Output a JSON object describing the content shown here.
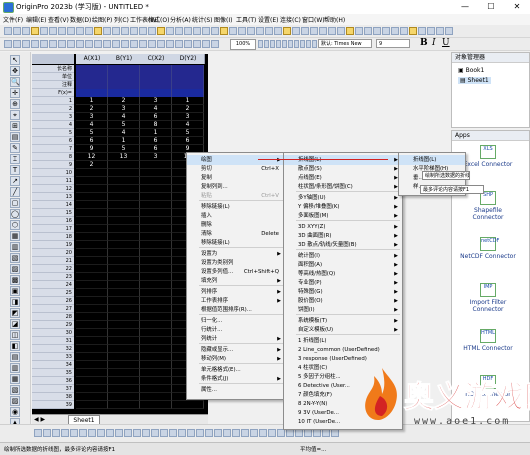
{
  "window": {
    "title": "OriginPro 2023b (学习版) - UNTITLED *",
    "buttons": [
      "—",
      "☐",
      "✕"
    ]
  },
  "menubar": [
    "文件(F)",
    "编辑(E)",
    "查看(V)",
    "数据(D)",
    "绘图(P)",
    "列(C)",
    "工作表(W)",
    "格式(O)",
    "分析(A)",
    "统计(S)",
    "图像(I)",
    "工具(T)",
    "设置(E)",
    "连接(C)",
    "窗口(W)",
    "帮助(H)"
  ],
  "toolbar2": {
    "zoom": "100%",
    "font_name": "默认: Times New",
    "font_size": "9"
  },
  "sheet": {
    "columns": [
      "A(X1)",
      "B(Y1)",
      "C(X2)",
      "D(Y2)"
    ],
    "header_rows": [
      "长名称",
      "单位",
      "注释",
      "F(x)="
    ],
    "rows": [
      [
        "1",
        "1",
        "2",
        "3",
        "1"
      ],
      [
        "2",
        "2",
        "3",
        "4",
        "2"
      ],
      [
        "3",
        "3",
        "4",
        "6",
        "3"
      ],
      [
        "4",
        "4",
        "5",
        "8",
        "4"
      ],
      [
        "5",
        "5",
        "4",
        "1",
        "5"
      ],
      [
        "6",
        "6",
        "1",
        "6",
        "6"
      ],
      [
        "7",
        "9",
        "5",
        "6",
        "9"
      ],
      [
        "8",
        "12",
        "13",
        "3",
        "12"
      ],
      [
        "9",
        "2",
        "",
        "",
        "2"
      ],
      [
        "10",
        "",
        "",
        "",
        ""
      ],
      [
        "11",
        "",
        "",
        "",
        ""
      ],
      [
        "12",
        "",
        "",
        "",
        ""
      ],
      [
        "13",
        "",
        "",
        "",
        ""
      ],
      [
        "14",
        "",
        "",
        "",
        ""
      ],
      [
        "15",
        "",
        "",
        "",
        ""
      ],
      [
        "16",
        "",
        "",
        "",
        ""
      ],
      [
        "17",
        "",
        "",
        "",
        ""
      ],
      [
        "18",
        "",
        "",
        "",
        ""
      ],
      [
        "19",
        "",
        "",
        "",
        ""
      ],
      [
        "20",
        "",
        "",
        "",
        ""
      ],
      [
        "21",
        "",
        "",
        "",
        ""
      ],
      [
        "22",
        "",
        "",
        "",
        ""
      ],
      [
        "23",
        "",
        "",
        "",
        ""
      ],
      [
        "24",
        "",
        "",
        "",
        ""
      ],
      [
        "25",
        "",
        "",
        "",
        ""
      ],
      [
        "26",
        "",
        "",
        "",
        ""
      ],
      [
        "27",
        "",
        "",
        "",
        ""
      ],
      [
        "28",
        "",
        "",
        "",
        ""
      ],
      [
        "29",
        "",
        "",
        "",
        ""
      ],
      [
        "30",
        "",
        "",
        "",
        ""
      ],
      [
        "31",
        "",
        "",
        "",
        ""
      ],
      [
        "32",
        "",
        "",
        "",
        ""
      ],
      [
        "33",
        "",
        "",
        "",
        ""
      ],
      [
        "34",
        "",
        "",
        "",
        ""
      ],
      [
        "35",
        "",
        "",
        "",
        ""
      ],
      [
        "36",
        "",
        "",
        "",
        ""
      ],
      [
        "37",
        "",
        "",
        "",
        ""
      ],
      [
        "38",
        "",
        "",
        "",
        ""
      ],
      [
        "39",
        "",
        "",
        "",
        ""
      ]
    ],
    "tab": "Sheet1"
  },
  "context_menu": [
    {
      "label": "绘图",
      "arrow": true,
      "hl": true
    },
    {
      "label": "剪切",
      "shortcut": "Ctrl+X"
    },
    {
      "label": "复制",
      "shortcut": ""
    },
    {
      "label": "复制列到...",
      "shortcut": ""
    },
    {
      "label": "粘贴",
      "shortcut": "Ctrl+V",
      "dis": true
    },
    {
      "label": "移除链接(L)",
      "sep": true
    },
    {
      "label": "插入"
    },
    {
      "label": "删除"
    },
    {
      "label": "清除",
      "shortcut": "Delete"
    },
    {
      "label": "移除链接(L)"
    },
    {
      "label": "设置为",
      "arrow": true,
      "sep": true
    },
    {
      "label": "设置为类别列"
    },
    {
      "label": "设置多列值...",
      "shortcut": "Ctrl+Shift+Q"
    },
    {
      "label": "填充列",
      "arrow": true
    },
    {
      "label": "列排序",
      "arrow": true,
      "sep": true
    },
    {
      "label": "工作表排序",
      "arrow": true
    },
    {
      "label": "根据值范围排序(R)..."
    },
    {
      "label": "归一化...",
      "sep": true
    },
    {
      "label": "行统计..."
    },
    {
      "label": "列统计",
      "arrow": true
    },
    {
      "label": "隐藏或显示...",
      "arrow": true,
      "sep": true
    },
    {
      "label": "移动列(M)",
      "arrow": true
    },
    {
      "label": "单元格格式(E)...",
      "sep": true
    },
    {
      "label": "条件格式(J)",
      "arrow": true
    },
    {
      "label": "属性...",
      "sep": true
    }
  ],
  "submenu1": [
    {
      "label": "折线图(L)",
      "arrow": true,
      "hl": true
    },
    {
      "label": "散点图(S)",
      "arrow": true
    },
    {
      "label": "点线图(E)",
      "arrow": true
    },
    {
      "label": "柱状图/条形图/饼图(C)",
      "arrow": true
    },
    {
      "label": "多Y轴图(U)",
      "arrow": true,
      "sep": true
    },
    {
      "label": "Y 偏移/堆叠图(K)",
      "arrow": true
    },
    {
      "label": "多面板图(M)",
      "arrow": true
    },
    {
      "label": "3D XYY(Z)",
      "arrow": true,
      "sep": true
    },
    {
      "label": "3D 曲面图(R)",
      "arrow": true
    },
    {
      "label": "3D 散点/轨线/矢量图(B)",
      "arrow": true
    },
    {
      "label": "统计图(I)",
      "arrow": true,
      "sep": true
    },
    {
      "label": "面积图(A)",
      "arrow": true
    },
    {
      "label": "等高线/热图(Q)",
      "arrow": true
    },
    {
      "label": "专业图(P)",
      "arrow": true
    },
    {
      "label": "特殊图(G)",
      "arrow": true
    },
    {
      "label": "股价图(O)",
      "arrow": true
    },
    {
      "label": "饼图(I)",
      "arrow": true
    },
    {
      "label": "系统模板(T)",
      "arrow": true,
      "sep": true
    },
    {
      "label": "自定义模板(U)",
      "arrow": true
    },
    {
      "label": "1 折线图(L)",
      "sep": true
    },
    {
      "label": "2 Line_common (UserDefined)"
    },
    {
      "label": "3 response (UserDefined)"
    },
    {
      "label": "4 柱状图(C)"
    },
    {
      "label": "5 多因子分组柱..."
    },
    {
      "label": "6 Detective (User..."
    },
    {
      "label": "7 颜色填充(F)"
    },
    {
      "label": "8 2N-Y-Y(N)"
    },
    {
      "label": "9 3V (UserDe..."
    },
    {
      "label": "10 IT (UserDe..."
    }
  ],
  "submenu2": [
    {
      "label": "折线图(L)",
      "hl": true
    },
    {
      "label": "水平阶梯图(H)"
    },
    {
      "label": "垂..."
    },
    {
      "label": "样..."
    }
  ],
  "tooltips": [
    {
      "text": "绘制所选数据的折线图"
    },
    {
      "text": "最多评论内容请按F1"
    }
  ],
  "object_manager": {
    "title": "对象管理器",
    "items": [
      "Book1",
      "Sheet1"
    ]
  },
  "apps": {
    "title": "Apps",
    "items": [
      {
        "icon": "XLS",
        "label": "Excel Connector"
      },
      {
        "icon": "SHP",
        "label": "Shapefile Connector"
      },
      {
        "icon": "netCDF",
        "label": "NetCDF Connector"
      },
      {
        "icon": "IMP",
        "label": "Import Filter Connector"
      },
      {
        "icon": "HTML",
        "label": "HTML Connector"
      },
      {
        "icon": "HDF",
        "label": "HDF Connector"
      }
    ]
  },
  "status": {
    "left": "绘制所选数据的折线图，最多评论内容请按F1",
    "right": "平均值=..."
  },
  "watermark": {
    "title": "奥义游戏网",
    "url": "www.aoe1.com"
  },
  "colors": {
    "sheet_bg": "#000000",
    "menu_hl": "#cfe3f7",
    "accent_red": "#d32323",
    "watermark_orange": "#f07a1a"
  }
}
